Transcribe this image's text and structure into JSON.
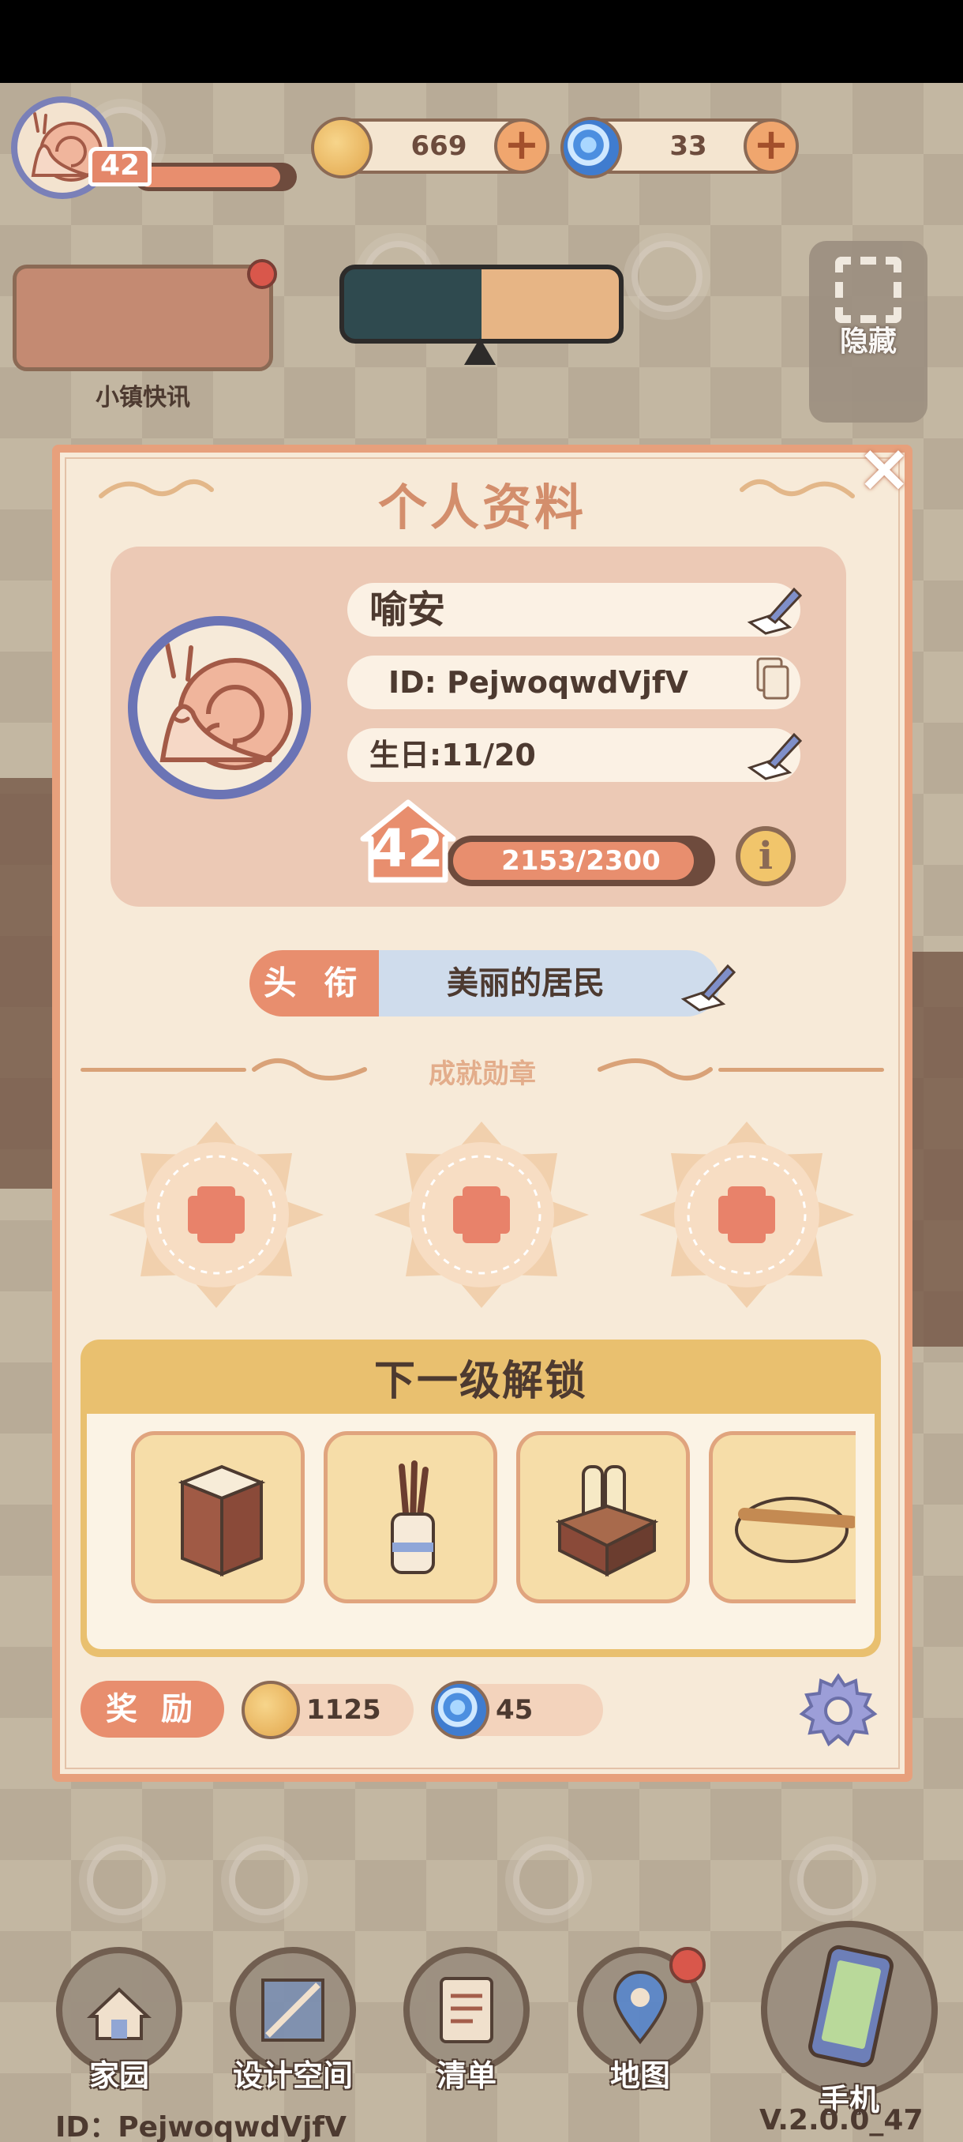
{
  "hud": {
    "level": "42",
    "coins": "669",
    "gems": "33"
  },
  "news": {
    "label": "小镇快讯"
  },
  "hide": {
    "label": "隐藏"
  },
  "profile": {
    "title": "个人资料",
    "name": "喻安",
    "id": "ID: PejwoqwdVjfV",
    "birthday": "生日:11/20",
    "level": "42",
    "xp": "2153/2300",
    "title_tag": "头 衔",
    "title_value": "美丽的居民",
    "achievements_label": "成就勋章",
    "next_unlock_title": "下一级解锁",
    "reward_label": "奖 励",
    "reward_coins": "1125",
    "reward_gems": "45",
    "unlock_items": [
      "cabinet-icon",
      "brush-pot-icon",
      "scroll-box-icon",
      "dough-rolling-pin-icon"
    ]
  },
  "nav": {
    "items": [
      {
        "label": "家园",
        "icon": "home-icon"
      },
      {
        "label": "设计空间",
        "icon": "design-space-icon"
      },
      {
        "label": "清单",
        "icon": "list-icon"
      },
      {
        "label": "地图",
        "icon": "map-icon"
      },
      {
        "label": "手机",
        "icon": "phone-icon"
      }
    ]
  },
  "footer": {
    "id": "ID：PejwoqwdVjfV",
    "version": "V.2.0.0_47"
  },
  "colors": {
    "accent": "#e88e6e",
    "panel": "#f7ead8",
    "text": "#4d3a30",
    "title": "#d38e6c"
  }
}
